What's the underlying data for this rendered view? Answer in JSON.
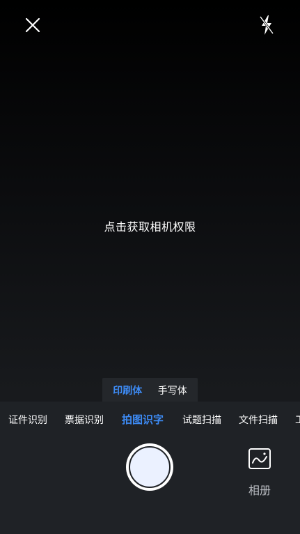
{
  "header": {
    "close_icon": "close-icon",
    "flash_icon": "flash-off-icon"
  },
  "viewfinder": {
    "permission_prompt": "点击获取相机权限"
  },
  "recognition_mode": {
    "options": [
      {
        "label": "印刷体",
        "active": true
      },
      {
        "label": "手写体",
        "active": false
      }
    ]
  },
  "scan_tabs": {
    "items": [
      {
        "label": "证件识别",
        "active": false
      },
      {
        "label": "票据识别",
        "active": false
      },
      {
        "label": "拍图识字",
        "active": true
      },
      {
        "label": "试题扫描",
        "active": false
      },
      {
        "label": "文件扫描",
        "active": false
      },
      {
        "label": "工",
        "active": false
      }
    ]
  },
  "controls": {
    "shutter_icon": "shutter-button",
    "album_label": "相册",
    "album_icon": "image-icon"
  },
  "colors": {
    "accent": "#3d8bf5",
    "text": "#ffffff",
    "panel": "#1f2226",
    "muted_text": "#b8bbc0"
  }
}
